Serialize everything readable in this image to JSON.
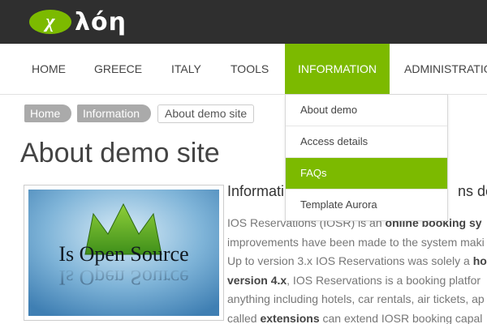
{
  "logo": {
    "mark": "χ",
    "text": "λόη"
  },
  "nav": {
    "items": [
      {
        "label": "HOME"
      },
      {
        "label": "GREECE"
      },
      {
        "label": "ITALY"
      },
      {
        "label": "TOOLS"
      },
      {
        "label": "INFORMATION",
        "active": true
      },
      {
        "label": "ADMINISTRATIO"
      }
    ]
  },
  "dropdown": {
    "items": [
      {
        "label": "About demo"
      },
      {
        "label": "Access details"
      },
      {
        "label": "FAQs",
        "active": true
      },
      {
        "label": "Template Aurora"
      }
    ]
  },
  "breadcrumb": {
    "items": [
      "Home",
      "Information",
      "About demo site"
    ]
  },
  "page": {
    "title": "About demo site",
    "section_title": "Informati",
    "section_title_tail": "ns dem",
    "image_text": "Is Open Source",
    "para": [
      [
        "IOS Reservations (IOSR) is an ",
        "online booking sy"
      ],
      [
        "improvements have been made to the system maki"
      ],
      [
        "Up to version 3.x IOS Reservations was solely a ",
        "ho"
      ],
      [
        "version 4.x",
        ", IOS Reservations is a booking platfor"
      ],
      [
        "anything including hotels, car rentals, air tickets, ap"
      ],
      [
        "called ",
        "extensions",
        " can extend IOSR booking capal"
      ]
    ]
  },
  "colors": {
    "accent": "#7cba00",
    "topbar": "#2f2f2f"
  }
}
